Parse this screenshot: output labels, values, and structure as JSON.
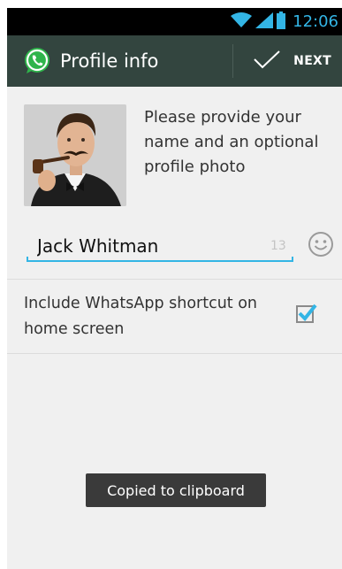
{
  "status_bar": {
    "time": "12:06",
    "icons": [
      "wifi-icon",
      "signal-icon",
      "battery-icon"
    ]
  },
  "action_bar": {
    "title": "Profile info",
    "next_label": "NEXT",
    "logo_icon": "whatsapp-logo",
    "next_icon": "checkmark-icon",
    "background_color": "#33453f"
  },
  "profile": {
    "prompt": "Please provide your name and an optional profile photo",
    "photo_icon": "profile-photo"
  },
  "name_field": {
    "value": "Jack Whitman",
    "remaining_chars": "13",
    "emoji_icon": "smiley-icon",
    "accent_color": "#33b5e5"
  },
  "shortcut": {
    "label": "Include WhatsApp shortcut on home screen",
    "checked": true
  },
  "toast": {
    "message": "Copied to clipboard"
  }
}
